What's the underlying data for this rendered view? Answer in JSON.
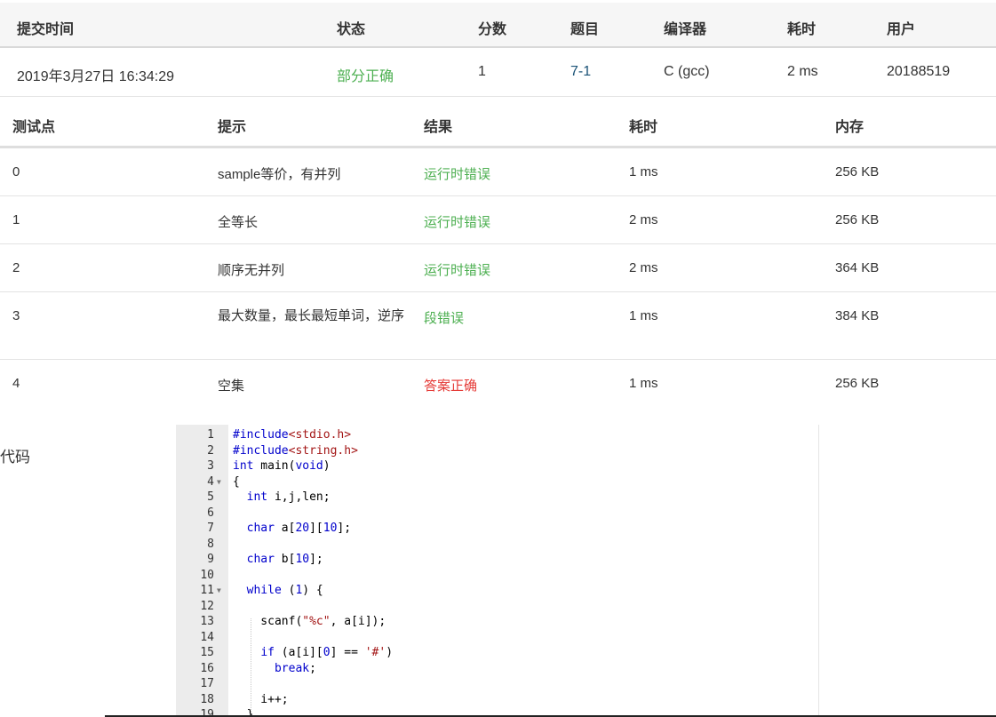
{
  "submission": {
    "headers": [
      "提交时间",
      "状态",
      "分数",
      "题目",
      "编译器",
      "耗时",
      "用户"
    ],
    "time": "2019年3月27日 16:34:29",
    "status": "部分正确",
    "score": "1",
    "problem": "7-1",
    "compiler": "C (gcc)",
    "elapsed": "2 ms",
    "user": "20188519"
  },
  "cases": {
    "headers": [
      "测试点",
      "提示",
      "结果",
      "耗时",
      "内存"
    ],
    "rows": [
      {
        "id": "0",
        "hint": "sample等价，有并列",
        "result": "运行时错误",
        "time": "1 ms",
        "memory": "256 KB"
      },
      {
        "id": "1",
        "hint": "全等长",
        "result": "运行时错误",
        "time": "2 ms",
        "memory": "256 KB"
      },
      {
        "id": "2",
        "hint": "顺序无并列",
        "result": "运行时错误",
        "time": "2 ms",
        "memory": "364 KB"
      },
      {
        "id": "3",
        "hint": "最大数量，最长最短单词，逆序",
        "result": "段错误",
        "time": "1 ms",
        "memory": "384 KB"
      },
      {
        "id": "4",
        "hint": "空集",
        "result": "答案正确",
        "time": "1 ms",
        "memory": "256 KB"
      }
    ]
  },
  "colors": {
    "partial": "#4caf50",
    "runtime_error": "#4caf50",
    "segfault": "#4caf50",
    "accepted": "#e53935",
    "problem_link": "#1a5276"
  },
  "code": {
    "label": "代码",
    "lines": [
      "#include<stdio.h>",
      "#include<string.h>",
      "int main(void)",
      "{",
      "  int i,j,len;",
      "",
      "  char a[20][10];",
      "",
      "  char b[10];",
      "",
      "  while (1) {",
      "",
      "    scanf(\"%c\", a[i]);",
      "",
      "    if (a[i][0] == '#')",
      "      break;",
      "",
      "    i++;",
      "  }"
    ],
    "fold_markers": [
      4,
      11
    ]
  }
}
